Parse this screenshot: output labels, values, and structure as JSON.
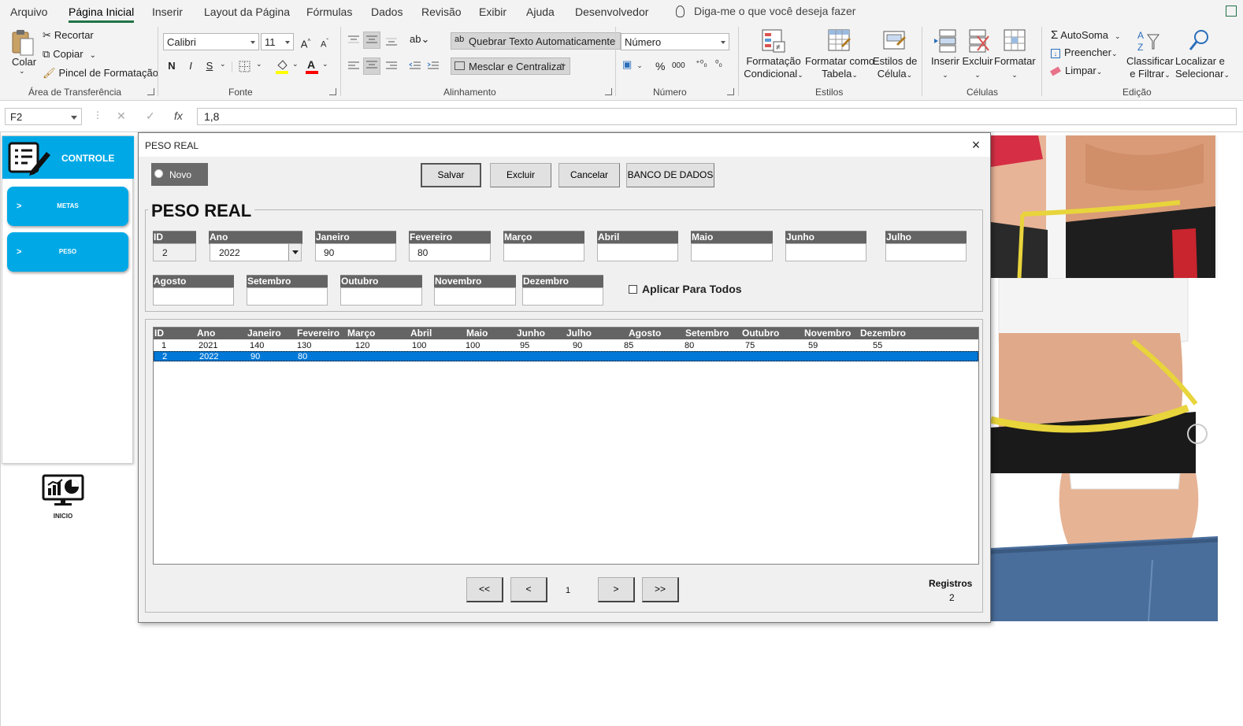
{
  "ribbon_tabs": [
    "Arquivo",
    "Página Inicial",
    "Inserir",
    "Layout da Página",
    "Fórmulas",
    "Dados",
    "Revisão",
    "Exibir",
    "Ajuda",
    "Desenvolvedor"
  ],
  "active_tab": "Página Inicial",
  "tell_me": "Diga-me o que você deseja fazer",
  "clipboard": {
    "paste": "Colar",
    "cut": "Recortar",
    "copy": "Copiar",
    "format_painter": "Pincel de Formatação",
    "group": "Área de Transferência"
  },
  "font": {
    "name": "Calibri",
    "size": "11",
    "grow": "A",
    "shrink": "A",
    "bold": "N",
    "italic": "I",
    "underline": "S",
    "color": "A",
    "group": "Fonte",
    "fill_color": "#ffff00",
    "font_color": "#ff0000"
  },
  "alignment": {
    "wrap_text": "Quebrar Texto Automaticamente",
    "merge_center": "Mesclar e Centralizar",
    "group": "Alinhamento"
  },
  "number": {
    "format": "Número",
    "percent": "%",
    "thousands": "000",
    "group": "Número"
  },
  "styles": {
    "conditional": [
      "Formatação",
      "Condicional"
    ],
    "format_table": [
      "Formatar como",
      "Tabela"
    ],
    "cell_styles": [
      "Estilos de",
      "Célula"
    ],
    "group": "Estilos"
  },
  "cells": {
    "insert": "Inserir",
    "delete": "Excluir",
    "format": "Formatar",
    "group": "Células"
  },
  "editing": {
    "autosum": "AutoSoma",
    "fill": "Preencher",
    "clear": "Limpar",
    "sort_filter": [
      "Classificar",
      "e Filtrar"
    ],
    "find_select": [
      "Localizar e",
      "Selecionar"
    ],
    "group": "Edição"
  },
  "formula_bar": {
    "name_box": "F2",
    "fx": "fx",
    "value": "1,8"
  },
  "sidebar": {
    "title": "CONTROLE",
    "items": [
      {
        "chevron": ">",
        "label": "METAS"
      },
      {
        "chevron": ">",
        "label": "PESO"
      }
    ],
    "home_label": "INICIO",
    "accent": "#00a9e6"
  },
  "dialog": {
    "title": "PESO REAL",
    "close": "×",
    "novo": "Novo",
    "buttons": {
      "save": "Salvar",
      "delete": "Excluir",
      "cancel": "Cancelar",
      "database": "BANCO DE DADOS"
    },
    "heading": "PESO REAL",
    "fields": {
      "id": {
        "label": "ID",
        "value": "2"
      },
      "ano": {
        "label": "Ano",
        "value": "2022"
      },
      "janeiro": {
        "label": "Janeiro",
        "value": "90"
      },
      "fevereiro": {
        "label": "Fevereiro",
        "value": "80"
      },
      "marco": {
        "label": "Março",
        "value": ""
      },
      "abril": {
        "label": "Abril",
        "value": ""
      },
      "maio": {
        "label": "Maio",
        "value": ""
      },
      "junho": {
        "label": "Junho",
        "value": ""
      },
      "julho": {
        "label": "Julho",
        "value": ""
      },
      "agosto": {
        "label": "Agosto",
        "value": ""
      },
      "setembro": {
        "label": "Setembro",
        "value": ""
      },
      "outubro": {
        "label": "Outubro",
        "value": ""
      },
      "novembro": {
        "label": "Novembro",
        "value": ""
      },
      "dezembro": {
        "label": "Dezembro",
        "value": ""
      }
    },
    "apply_all": "Aplicar Para Todos",
    "list": {
      "columns": [
        "ID",
        "Ano",
        "Janeiro",
        "Fevereiro",
        "Março",
        "Abril",
        "Maio",
        "Junho",
        "Julho",
        "Agosto",
        "Setembro",
        "Outubro",
        "Novembro",
        "Dezembro"
      ],
      "rows": [
        [
          "1",
          "2021",
          "140",
          "130",
          "120",
          "100",
          "100",
          "95",
          "90",
          "85",
          "80",
          "75",
          "59",
          "55"
        ],
        [
          "2",
          "2022",
          "90",
          "80",
          "",
          "",
          "",
          "",
          "",
          "",
          "",
          "",
          "",
          ""
        ]
      ],
      "selected_row": 1,
      "selection_color": "#0078d7"
    },
    "pager": {
      "first": "<<",
      "prev": "<",
      "page": "1",
      "next": ">",
      "last": ">>"
    },
    "records_label": "Registros",
    "records_value": "2"
  }
}
